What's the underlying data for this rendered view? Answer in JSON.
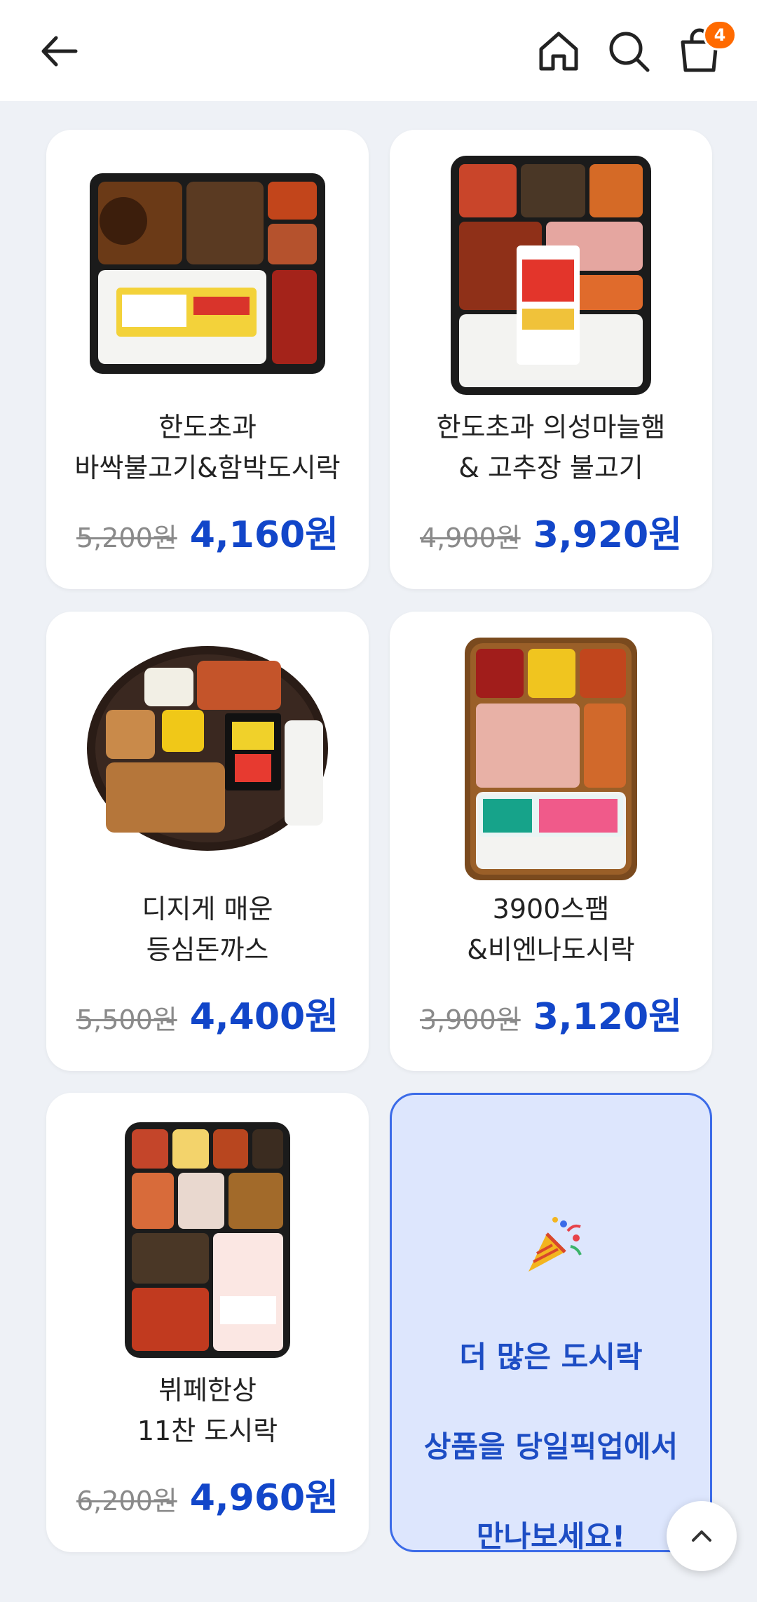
{
  "header": {
    "cart_count": "4",
    "icons": [
      "back-arrow-icon",
      "home-icon",
      "search-icon",
      "cart-icon"
    ]
  },
  "products": [
    {
      "name_line1": "한도초과",
      "name_line2": "바싹불고기&함박도시락",
      "original_price": "5,200원",
      "sale_price": "4,160원"
    },
    {
      "name_line1": "한도초과 의성마늘햄",
      "name_line2": "& 고추장 불고기",
      "original_price": "4,900원",
      "sale_price": "3,920원"
    },
    {
      "name_line1": "디지게 매운",
      "name_line2": "등심돈까스",
      "original_price": "5,500원",
      "sale_price": "4,400원"
    },
    {
      "name_line1": "3900스팸",
      "name_line2": "&비엔나도시락",
      "original_price": "3,900원",
      "sale_price": "3,120원"
    },
    {
      "name_line1": "뷔페한상",
      "name_line2": "11찬 도시락",
      "original_price": "6,200원",
      "sale_price": "4,960원"
    }
  ],
  "promo": {
    "line1": "더 많은 도시락",
    "line2": "상품을 당일픽업에서",
    "line3": "만나보세요!"
  },
  "colors": {
    "accent": "#1246c9",
    "badge": "#ff6a00",
    "promo_bg": "#dde6fd",
    "promo_border": "#3b6be8",
    "page_bg": "#eef1f6"
  }
}
